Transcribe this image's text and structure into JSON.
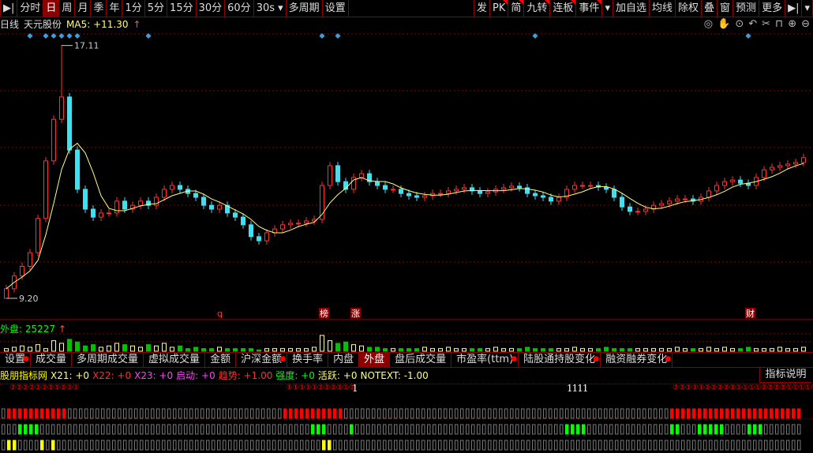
{
  "toolbar": {
    "left": [
      "分时",
      "日",
      "周",
      "月",
      "季",
      "年",
      "1分",
      "5分",
      "15分",
      "30分",
      "60分",
      "30s ▾",
      "多周期",
      "设置"
    ],
    "selected": "日",
    "right": [
      {
        "label": "发"
      },
      {
        "label": "PK",
        "flag": true
      },
      {
        "label": "简",
        "flag": true
      },
      {
        "label": "九转",
        "flag": true
      },
      {
        "label": "连板",
        "flag": true
      },
      {
        "label": "事件",
        "flag": true
      },
      {
        "label": "▾"
      },
      {
        "label": "加自选"
      },
      {
        "label": "均线"
      },
      {
        "label": "除权"
      },
      {
        "label": "叠"
      },
      {
        "label": "窗"
      },
      {
        "label": "预测"
      },
      {
        "label": "更多"
      },
      {
        "label": "▶|"
      },
      {
        "label": "▾"
      }
    ]
  },
  "info": {
    "period": "日线",
    "stock": "天元股份",
    "ma_label": "MA5:",
    "ma_value": "+11.30",
    "arrow": "↑"
  },
  "tools": [
    {
      "icon": "eye-icon",
      "glyph": "◎"
    },
    {
      "icon": "hand-icon",
      "glyph": "✋"
    },
    {
      "icon": "play-circle-icon",
      "glyph": "⊙"
    },
    {
      "icon": "undo-icon",
      "glyph": "↶"
    },
    {
      "icon": "scissors-icon",
      "glyph": "✂"
    },
    {
      "icon": "lock-icon",
      "glyph": "⊓"
    },
    {
      "icon": "zoom-in-icon",
      "glyph": "⊕"
    },
    {
      "icon": "zoom-out-icon",
      "glyph": "⊖"
    }
  ],
  "chart_data": {
    "type": "candlestick",
    "high_label": "17.11",
    "low_label": "9.20",
    "high_index": 7,
    "low_index": 0,
    "closes": [
      9.5,
      9.9,
      10.2,
      10.63,
      11.7,
      13.5,
      14.8,
      15.5,
      13.84,
      12.61,
      11.99,
      11.74,
      11.87,
      11.87,
      12.24,
      11.99,
      12.11,
      12.24,
      12.11,
      12.36,
      12.61,
      12.73,
      12.61,
      12.48,
      12.36,
      12.11,
      11.99,
      12.11,
      11.87,
      11.74,
      11.5,
      11.13,
      11.0,
      11.25,
      11.37,
      11.5,
      11.55,
      11.55,
      11.62,
      11.67,
      12.73,
      13.35,
      12.85,
      12.61,
      12.98,
      13.1,
      12.85,
      12.73,
      12.61,
      12.61,
      12.48,
      12.41,
      12.36,
      12.41,
      12.48,
      12.48,
      12.56,
      12.61,
      12.66,
      12.56,
      12.48,
      12.53,
      12.61,
      12.66,
      12.71,
      12.66,
      12.48,
      12.41,
      12.36,
      12.24,
      12.36,
      12.61,
      12.73,
      12.73,
      12.73,
      12.68,
      12.61,
      12.36,
      12.06,
      11.92,
      11.92,
      11.99,
      12.11,
      12.16,
      12.24,
      12.31,
      12.31,
      12.24,
      12.36,
      12.56,
      12.73,
      12.85,
      12.9,
      12.8,
      12.73,
      12.98,
      13.22,
      13.3,
      13.35,
      13.4,
      13.45,
      13.6
    ],
    "volumes": [
      2,
      3,
      4,
      3,
      5,
      2,
      8,
      6,
      9,
      7,
      4,
      5,
      3,
      4,
      6,
      5,
      4,
      3,
      5,
      4,
      6,
      3,
      4,
      2,
      3,
      2,
      2,
      3,
      2,
      2,
      2,
      2,
      1,
      2,
      2,
      2,
      2,
      2,
      2,
      3,
      12,
      8,
      6,
      7,
      5,
      4,
      3,
      3,
      2,
      2,
      2,
      2,
      2,
      3,
      2,
      2,
      3,
      2,
      2,
      2,
      2,
      2,
      3,
      2,
      2,
      2,
      3,
      2,
      2,
      2,
      2,
      2,
      3,
      2,
      2,
      2,
      3,
      2,
      2,
      2,
      2,
      2,
      2,
      2,
      2,
      3,
      2,
      2,
      2,
      3,
      2,
      3,
      2,
      2,
      3,
      2,
      2,
      2,
      3,
      2,
      2,
      3
    ],
    "event_markers": [
      3,
      5,
      6,
      7,
      8,
      9,
      18,
      40,
      42,
      67,
      94
    ],
    "labels": [
      {
        "index": 27,
        "text": "q",
        "boxed": false
      },
      {
        "index": 40,
        "text": "榜",
        "boxed": true
      },
      {
        "index": 44,
        "text": "涨",
        "boxed": true
      },
      {
        "index": 94,
        "text": "财",
        "boxed": true
      }
    ],
    "colors": {
      "up": "#ff3030",
      "down": "#40e0f0",
      "ma": "#ffff80",
      "vol_up": "#ffff99",
      "vol_down": "#00c000"
    }
  },
  "volume": {
    "label": "外盘:",
    "value": "25227",
    "arrow": "↑"
  },
  "tabs": [
    {
      "label": "设置",
      "dot": true
    },
    {
      "label": "成交量"
    },
    {
      "label": "多周期成交量"
    },
    {
      "label": "虚拟成交量"
    },
    {
      "label": "金额"
    },
    {
      "label": "沪深金额",
      "dot": true
    },
    {
      "label": "换手率"
    },
    {
      "label": "内盘"
    },
    {
      "label": "外盘",
      "sel": true
    },
    {
      "label": "盘后成交量"
    },
    {
      "label": "市盈率(ttm)",
      "dot": true
    },
    {
      "label": "陆股通持股变化",
      "dot": true
    },
    {
      "label": "融资融券变化",
      "dot": true
    }
  ],
  "indicator": {
    "items": [
      {
        "t": "股朋指标网",
        "c": "#ffff00"
      },
      {
        "t": "X21: +0",
        "c": "#ffff80"
      },
      {
        "t": "X22: +0",
        "c": "#ff3030"
      },
      {
        "t": "X23: +0",
        "c": "#ff40ff"
      },
      {
        "t": "启动: +0",
        "c": "#ff40ff"
      },
      {
        "t": "趋势: +1.00",
        "c": "#ff3030"
      },
      {
        "t": "强度: +0",
        "c": "#00ff00"
      },
      {
        "t": "活跃: +0",
        "c": "#ffff80"
      },
      {
        "t": "NOTEXT: -1.00",
        "c": "#ffff80"
      }
    ],
    "explain": "指标说明"
  },
  "circles": {
    "left": "②②②②②②②①②①①",
    "mid": "①①①①①②②②②①①",
    "mid_num": "1",
    "center_num": "1111",
    "right": "②②①①①②②②②②①①①①②②②②①①①①①①①"
  },
  "signals": {
    "cells": 145,
    "rows": [
      {
        "color": "#ff0000",
        "on": [
          [
            1,
            11
          ],
          [
            51,
            61
          ],
          [
            121,
            144
          ]
        ]
      },
      {
        "color": "#00ff00",
        "on": [
          [
            3,
            6
          ],
          [
            56,
            58
          ],
          [
            63,
            63
          ],
          [
            102,
            105
          ],
          [
            121,
            122
          ],
          [
            126,
            130
          ],
          [
            135,
            137
          ]
        ]
      },
      {
        "color": "#ffff00",
        "on": [
          [
            1,
            2
          ],
          [
            7,
            7
          ],
          [
            9,
            9
          ],
          [
            58,
            59
          ]
        ]
      }
    ]
  }
}
